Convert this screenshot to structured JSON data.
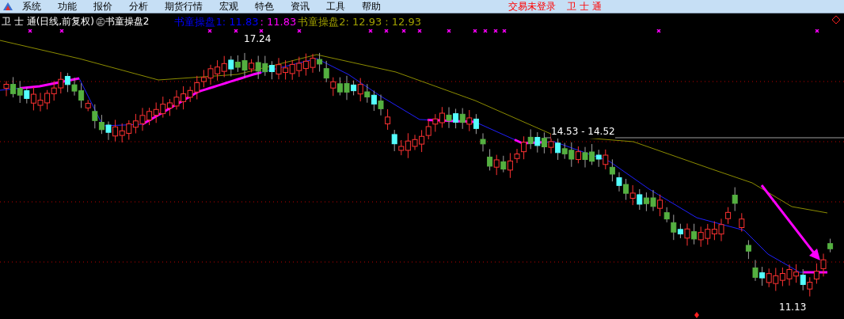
{
  "menu": {
    "items": [
      "系统",
      "功能",
      "报价",
      "分析",
      "期货行情",
      "宏观",
      "特色",
      "资讯",
      "工具",
      "帮助"
    ],
    "status": "交易未登录",
    "stock": "卫 士 通"
  },
  "header": {
    "title": "卫 士 通(日线,前复权)",
    "formula": "㊣书童操盘2",
    "segments": [
      {
        "text": "书童操盘1: 11.83",
        "color": "#0000ff"
      },
      {
        "text": ": 11.83",
        "color": "#ff00ff"
      },
      {
        "text": "书童操盘2: 12.93 : 12.93",
        "color": "#a0a000"
      }
    ]
  },
  "labels": {
    "high": "17.24",
    "mid": "14.53 - 14.52",
    "low": "11.13"
  }
}
